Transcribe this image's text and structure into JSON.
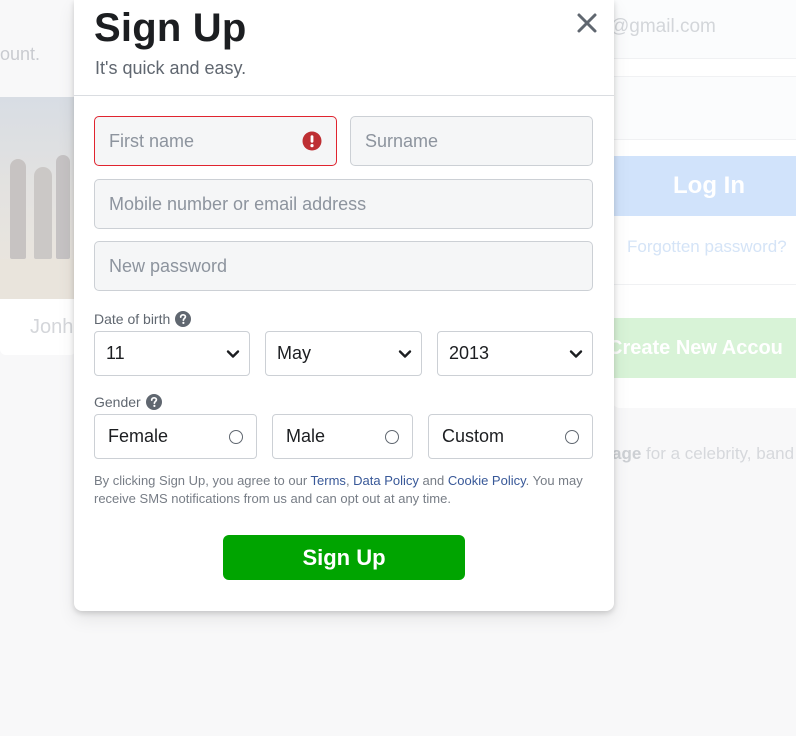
{
  "background": {
    "left_snippet": "ount.",
    "left_name": "Jonh",
    "email_snippet": "@gmail.com",
    "login_label": "Log In",
    "forgot_label": "Forgotten password?",
    "create_label": "Create New Accou",
    "page_bold": "age",
    "page_rest": " for a celebrity, band"
  },
  "modal": {
    "title": "Sign Up",
    "subtitle": "It's quick and easy.",
    "close_icon": "close-icon",
    "fields": {
      "first_name": {
        "placeholder": "First name",
        "value": "",
        "state": "error"
      },
      "surname": {
        "placeholder": "Surname",
        "value": ""
      },
      "contact": {
        "placeholder": "Mobile number or email address",
        "value": ""
      },
      "password": {
        "placeholder": "New password",
        "value": ""
      }
    },
    "dob": {
      "label": "Date of birth",
      "day": "11",
      "month": "May",
      "year": "2013"
    },
    "gender": {
      "label": "Gender",
      "options": [
        "Female",
        "Male",
        "Custom"
      ]
    },
    "terms": {
      "part1": "By clicking Sign Up, you agree to our ",
      "terms_link": "Terms",
      "sep1": ", ",
      "data_link": "Data Policy",
      "sep2": " and ",
      "cookie_link": "Cookie Policy",
      "part2": ". You may receive SMS notifications from us and can opt out at any time."
    },
    "signup_label": "Sign Up"
  },
  "colors": {
    "primary_green": "#00a400",
    "error_red": "#e0242f",
    "link_blue": "#385898"
  }
}
